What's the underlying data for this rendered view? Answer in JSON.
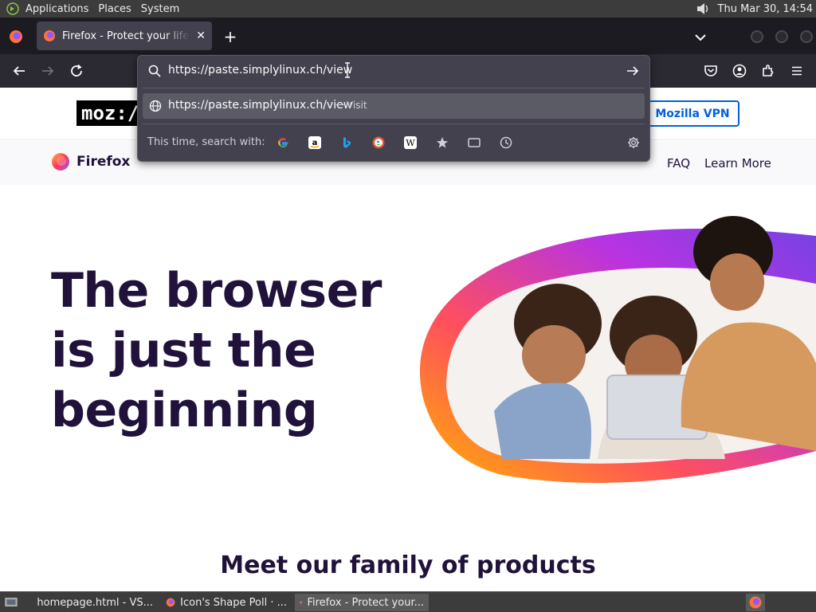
{
  "top_panel": {
    "menus": [
      "Applications",
      "Places",
      "System"
    ],
    "clock": "Thu Mar 30, 14:54"
  },
  "tabs": [
    {
      "title": "Firefox - Protect your life online"
    }
  ],
  "urlbar": {
    "value": "https://paste.simplylinux.ch/view",
    "result": {
      "url": "https://paste.simplylinux.ch/view",
      "separator": "—",
      "action": "Visit"
    },
    "one_off_label": "This time, search with:",
    "engines": [
      "Google",
      "Amazon",
      "Bing",
      "DuckDuckGo",
      "Wikipedia",
      "Bookmarks",
      "Tabs",
      "History"
    ]
  },
  "page": {
    "header_logo": "moz://a",
    "vpn_button": "Mozilla VPN",
    "brand": "Firefox",
    "nav_links": [
      "FAQ",
      "Learn More"
    ],
    "hero_lines": [
      "The browser",
      "is just the",
      "beginning"
    ],
    "section_heading": "Meet our family of products"
  },
  "taskbar": {
    "items": [
      "homepage.html - VS...",
      "Icon's Shape Poll · ...",
      "Firefox - Protect your..."
    ]
  },
  "colors": {
    "panel": "#3c3c3c",
    "tab_bar": "#1c1b22",
    "toolbar": "#2b2a33",
    "popup": "#42414d",
    "accent_blue": "#0060df",
    "heading": "#20123a"
  }
}
